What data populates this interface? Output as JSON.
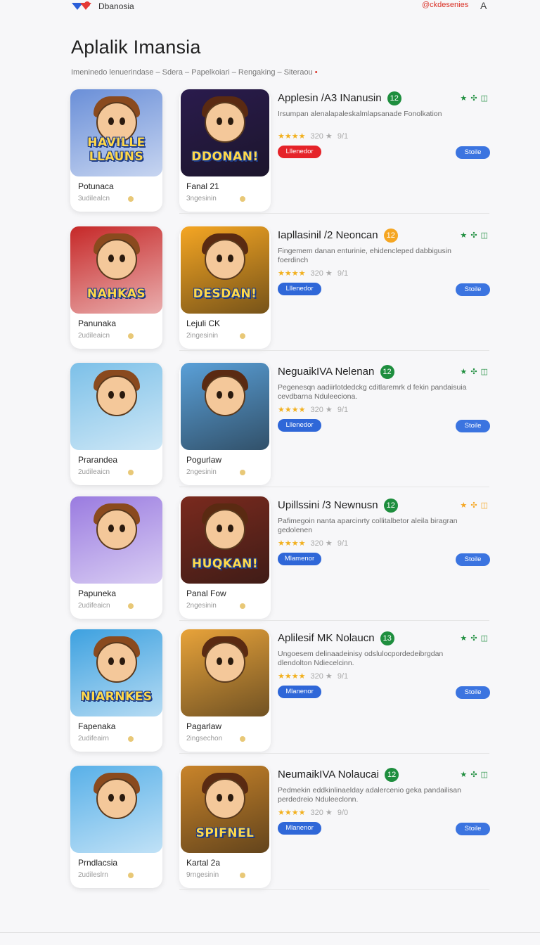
{
  "header": {
    "brand": "Dbanosia",
    "top_link": "@ckdesenies",
    "top_letter": "A",
    "logo_colors": [
      "#2b5fd9",
      "#e53935"
    ]
  },
  "page": {
    "title": "Aplalik Imansia",
    "breadcrumb": "Imeninedo lenuerindase – Sdera – Papelkoiari – Rengaking – Siteraou",
    "breadcrumb_dot": "•"
  },
  "rows": [
    {
      "card_a": {
        "name": "Potunaca",
        "sub": "3udilealcn",
        "art_text": "HAVILLE LLAUNS",
        "bg": "#6a8fd8"
      },
      "card_b": {
        "name": "Fanal 21",
        "sub": "3ngesinin",
        "art_text": "DDONAN!",
        "bg": "#2a1b4d"
      },
      "title": "Applesin /A3 INanusin",
      "badge": "12",
      "badge_color": "#1e8e3e",
      "rating_icons": "★ ✣ ◫",
      "rating_color": "#1e8e3e",
      "desc": "Irsumpan alenalapaleskalmlapsanade Fonolkation",
      "stars": "★★★★",
      "score": "320 ★",
      "count": "9/1",
      "install": "Lllenedor",
      "install_red": true,
      "open": "Stoile"
    },
    {
      "card_a": {
        "name": "Panunaka",
        "sub": "2udileaicn",
        "art_text": "NAHKAS",
        "bg": "#c62828"
      },
      "card_b": {
        "name": "Lejuli CK",
        "sub": "2ingesinin",
        "art_text": "DESDAN!",
        "bg": "#f5a623"
      },
      "title": "Iapllasinil /2 Neoncan",
      "badge": "12",
      "badge_color": "#f5a623",
      "rating_icons": "★ ✣ ◫",
      "rating_color": "#1e8e3e",
      "desc": "Fingemem danan enturinie, ehidencleped dabbigusin foerdinch",
      "stars": "★★★★",
      "score": "320 ★",
      "count": "9/1",
      "install": "Lllenedor",
      "install_red": false,
      "open": "Stoile"
    },
    {
      "card_a": {
        "name": "Prarandea",
        "sub": "2udileaicn",
        "art_text": "",
        "bg": "#7cc0e8"
      },
      "card_b": {
        "name": "Pogurlaw",
        "sub": "2ngesinin",
        "art_text": "",
        "bg": "#5aa0d8"
      },
      "title": "NeguaikIVA Nelenan",
      "badge": "12",
      "badge_color": "#1e8e3e",
      "rating_icons": "★ ✣ ◫",
      "rating_color": "#1e8e3e",
      "desc": "Pegenesqn aadiirlotdedckg cditlaremrk d fekin pandaisuia cevdbarna Nduleeciona.",
      "stars": "★★★★",
      "score": "320 ★",
      "count": "9/1",
      "install": "Lllenedor",
      "install_red": false,
      "open": "Stoile"
    },
    {
      "card_a": {
        "name": "Papuneka",
        "sub": "2udifeaicn",
        "art_text": "",
        "bg": "#9a7be0"
      },
      "card_b": {
        "name": "Panal Fow",
        "sub": "2ngesinin",
        "art_text": "HUQKAN!",
        "bg": "#7a2a1e"
      },
      "title": "Upillssini /3 Newnusn",
      "badge": "12",
      "badge_color": "#1e8e3e",
      "rating_icons": "★ ✣ ◫",
      "rating_color": "#f5a623",
      "desc": "Pafimegoin nanta aparcinrty collitalbetor aleila biragran gedolenen",
      "stars": "★★★★",
      "score": "320 ★",
      "count": "9/1",
      "install": "Mlamenor",
      "install_red": false,
      "open": "Stoile"
    },
    {
      "card_a": {
        "name": "Fapenaka",
        "sub": "2udifeairn",
        "art_text": "NIARNKES",
        "bg": "#3da1e0"
      },
      "card_b": {
        "name": "Pagarlaw",
        "sub": "2ingsechon",
        "art_text": "",
        "bg": "#e8a33a"
      },
      "title": "Aplilesif MK Nolaucn",
      "badge": "13",
      "badge_color": "#1e8e3e",
      "rating_icons": "★ ✣ ◫",
      "rating_color": "#1e8e3e",
      "desc": "Ungoesem delinaadeinisy odslulocpordedeibrgdan dlendolton Ndiecelcinn.",
      "stars": "★★★★",
      "score": "320 ★",
      "count": "9/1",
      "install": "Mlanenor",
      "install_red": false,
      "open": "Stoile"
    },
    {
      "card_a": {
        "name": "Prndlacsia",
        "sub": "2udileslrn",
        "art_text": "",
        "bg": "#58b0e8"
      },
      "card_b": {
        "name": "Kartal 2a",
        "sub": "9rngesinin",
        "art_text": "SPIFNEL",
        "bg": "#c9842a"
      },
      "title": "NeumaikIVA Nolaucai",
      "badge": "12",
      "badge_color": "#1e8e3e",
      "rating_icons": "★ ✣ ◫",
      "rating_color": "#1e8e3e",
      "desc": "Pedmekin eddkinlinaelday adalercenio geka pandailisan perdedreio Nduleeclonn.",
      "stars": "★★★★",
      "score": "320 ★",
      "count": "9/0",
      "install": "Mlanenor",
      "install_red": false,
      "open": "Stoile"
    }
  ]
}
